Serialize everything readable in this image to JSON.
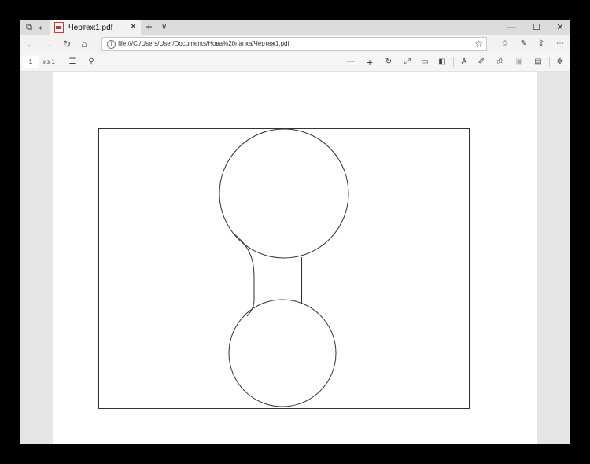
{
  "tab": {
    "title": "Чертеж1.pdf",
    "close": "✕",
    "new_tab": "+",
    "tab_list": "∨"
  },
  "window_controls": {
    "minimize": "—",
    "maximize": "☐",
    "close": "✕"
  },
  "address_bar": {
    "url": "file:///C:/Users/User/Documents/Нова%20папка/Чертеж1.pdf"
  },
  "pdf_toolbar": {
    "page_number": "1",
    "page_count_label": "из 1",
    "zoom_out": "—",
    "zoom_in": "+"
  }
}
